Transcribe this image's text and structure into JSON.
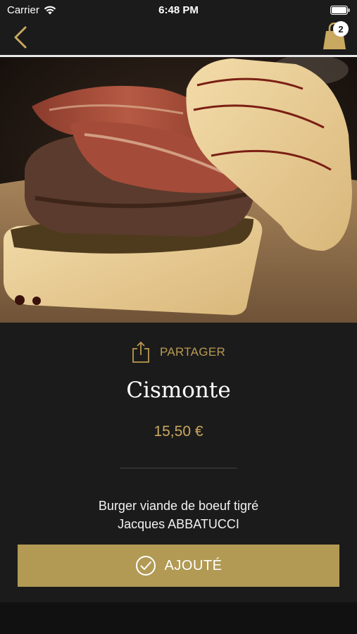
{
  "status_bar": {
    "carrier": "Carrier",
    "time": "6:48 PM",
    "icons": [
      "wifi-icon",
      "battery-icon"
    ]
  },
  "nav": {
    "back_icon": "chevron-left-icon",
    "cart_icon": "shopping-bag-icon",
    "cart_count": "2"
  },
  "product": {
    "image_subject": "burger photo",
    "share_label": "PARTAGER",
    "name": "Cismonte",
    "price": "15,50 €",
    "description_line1": "Burger viande de boeuf tigré",
    "description_line2": "Jacques ABBATUCCI"
  },
  "action": {
    "added_label": "AJOUTÉ",
    "icon": "check-circle-icon"
  },
  "colors": {
    "background": "#1b1b1b",
    "accent": "#b29a54",
    "gold_text": "#c9a85f"
  }
}
